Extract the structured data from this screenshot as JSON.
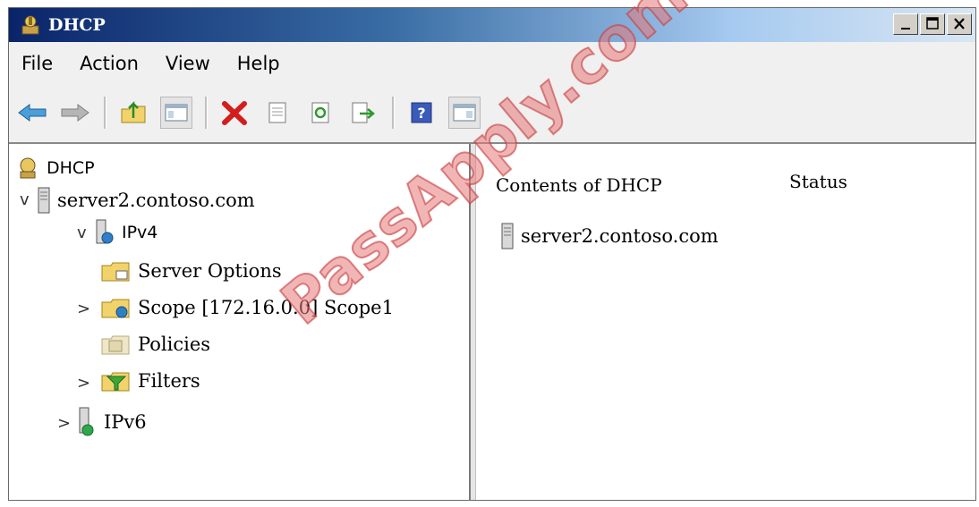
{
  "window": {
    "title": "DHCP",
    "controls": [
      "minimize-icon",
      "maximize-icon",
      "close-icon"
    ]
  },
  "menu": [
    {
      "label": "File"
    },
    {
      "label": "Action"
    },
    {
      "label": "View"
    },
    {
      "label": "Help"
    }
  ],
  "toolbar": [
    {
      "name": "back-button",
      "icon": "arrow-left-icon"
    },
    {
      "name": "forward-button",
      "icon": "arrow-right-icon"
    },
    {
      "name": "up-folder-button",
      "icon": "folder-up-icon"
    },
    {
      "name": "show-hide-tree-button",
      "icon": "console-tree-icon"
    },
    {
      "name": "delete-button",
      "icon": "red-x-icon"
    },
    {
      "name": "properties-button",
      "icon": "properties-icon"
    },
    {
      "name": "refresh-button",
      "icon": "refresh-icon"
    },
    {
      "name": "export-list-button",
      "icon": "export-icon"
    },
    {
      "name": "help-button",
      "icon": "help-icon"
    },
    {
      "name": "show-action-pane-button",
      "icon": "action-pane-icon"
    }
  ],
  "tree": {
    "root": "DHCP",
    "server": "server2.contoso.com",
    "ipv4": "IPv4",
    "server_options": "Server Options",
    "scope": "Scope [172.16.0.0] Scope1",
    "policies": "Policies",
    "filters": "Filters",
    "ipv6": "IPv6",
    "expanded_glyph": "v",
    "collapsed_glyph": ">"
  },
  "content": {
    "columns": [
      "Contents of DHCP",
      "Status"
    ],
    "rows": [
      {
        "name": "server2.contoso.com",
        "status": ""
      }
    ]
  },
  "watermark": "PassApply.com"
}
